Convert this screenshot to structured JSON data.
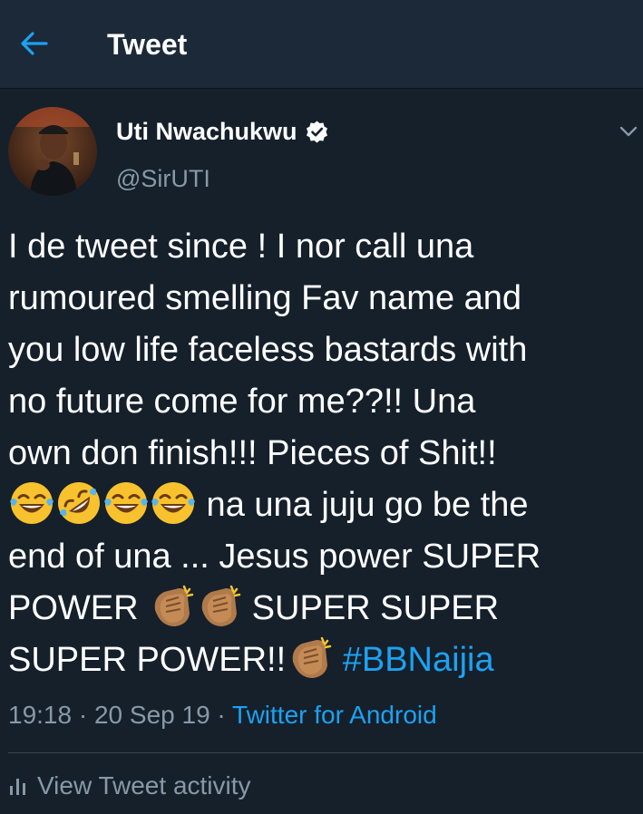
{
  "header": {
    "title": "Tweet",
    "back_icon": "arrow-left-icon",
    "accent_color": "#1da1f2"
  },
  "author": {
    "display_name": "Uti Nwachukwu",
    "handle": "@SirUTI",
    "verified": true
  },
  "tweet": {
    "lines": [
      "I de tweet since ! I nor call una",
      "rumoured smelling Fav name and",
      "you low life faceless bastards with",
      "no future come for me??!! Una",
      "own don finish!!! Pieces of Shit!!"
    ],
    "line6_text": " na una juju go be the",
    "line7": "end of una ... Jesus power SUPER",
    "line8_a": "POWER ",
    "line8_b": " SUPER SUPER",
    "line9_a": "SUPER POWER!!",
    "hashtag": "#BBNaijia",
    "emojis": [
      "face-with-tears-of-joy",
      "rolling-on-floor-laughing",
      "face-with-tears-of-joy",
      "face-with-tears-of-joy",
      "clapping-hands",
      "clapping-hands",
      "clapping-hands"
    ]
  },
  "meta": {
    "time": "19:18",
    "separator": " · ",
    "date": "20 Sep 19",
    "source": "Twitter for Android"
  },
  "activity": {
    "label": "View Tweet activity",
    "icon": "bar-chart-icon"
  },
  "colors": {
    "background": "#15202b",
    "header_background": "#1c2938",
    "primary_text": "#ffffff",
    "secondary_text": "#8899a6",
    "link": "#1da1f2"
  }
}
